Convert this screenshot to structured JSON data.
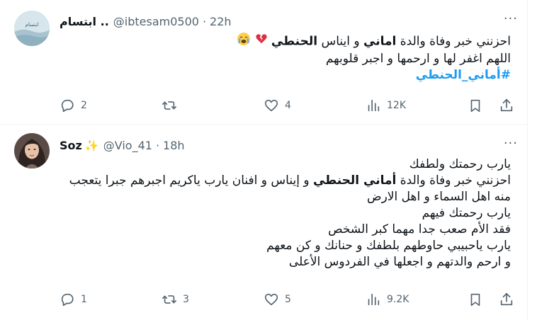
{
  "tweets": [
    {
      "display_name": "ابتسام ..",
      "handle": "@ibtesam0500",
      "separator": "·",
      "time": "22h",
      "lines": {
        "l1_prefix": "احزنني خبر وفاة والدة ",
        "l1_bold1": "اماني",
        "l1_mid": " و ايناس ",
        "l1_bold2": "الحنطي",
        "l2": "اللهم اغفر لها و ارحمها و اجبر قلوبهم",
        "hashtag": "#أماني_الحنطي"
      },
      "stats": {
        "replies": "2",
        "reposts": "",
        "likes": "4",
        "views": "12K"
      }
    },
    {
      "display_name": "Soz",
      "handle": "@Vio_41",
      "separator": "·",
      "time": "18h",
      "lines": {
        "l1": "يارب رحمتك ولطفك",
        "l2_prefix": "احزنني خبر وفاة والدة ",
        "l2_bold": "أماني الحنطي",
        "l2_suffix": " و إيناس و افنان يارب ياكريم اجبرهم جبرا يتعجب",
        "l3": "منه اهل السماء و اهل الارض",
        "l4": "يارب رحمتك فيهم",
        "l5": "فقد الأم صعب جدا مهما كبر الشخص",
        "l6": "يارب ياحبيبي حاوطهم بلطفك و حنانك و كن معهم",
        "l7": "و ارحم والدتهم و اجعلها في الفردوس الأعلى"
      },
      "stats": {
        "replies": "1",
        "reposts": "3",
        "likes": "5",
        "views": "9.2K"
      }
    }
  ],
  "icons": {
    "more": "more-dots-icon",
    "reply": "reply-bubble-icon",
    "repost": "repost-arrows-icon",
    "like": "heart-icon",
    "views": "views-bar-chart-icon",
    "bookmark": "bookmark-icon",
    "share": "share-upload-icon"
  }
}
